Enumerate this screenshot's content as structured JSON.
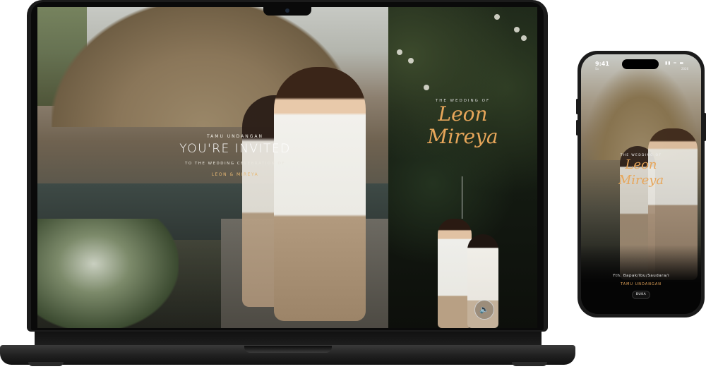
{
  "laptop": {
    "invitation": {
      "eyebrow": "TAMU UNDANGAN",
      "heading": "YOU'RE INVITED",
      "subheading": "TO THE WEDDING CELEBRATION OF",
      "couple_names": "LEON & MIREYA"
    },
    "side_panel": {
      "eyebrow": "THE WEDDING OF",
      "groom_script": "Leon",
      "bride_script": "Mireya",
      "scroll_icon": "chevron-double-down-icon",
      "sound_icon": "speaker-icon"
    }
  },
  "phone": {
    "status": {
      "time": "9:41",
      "day": "Sa",
      "year": "2026"
    },
    "eyebrow": "THE WEDDING OF",
    "groom_script": "Leon",
    "bride_script": "Mireya",
    "guest_greeting": "Yth. Bapak/Ibu/Saudara/i",
    "invitation_label": "TAMU UNDANGAN",
    "open_button": "BUKA"
  },
  "colors": {
    "accent_gold": "#e7a65a",
    "device_frame": "#1b1b1b"
  }
}
